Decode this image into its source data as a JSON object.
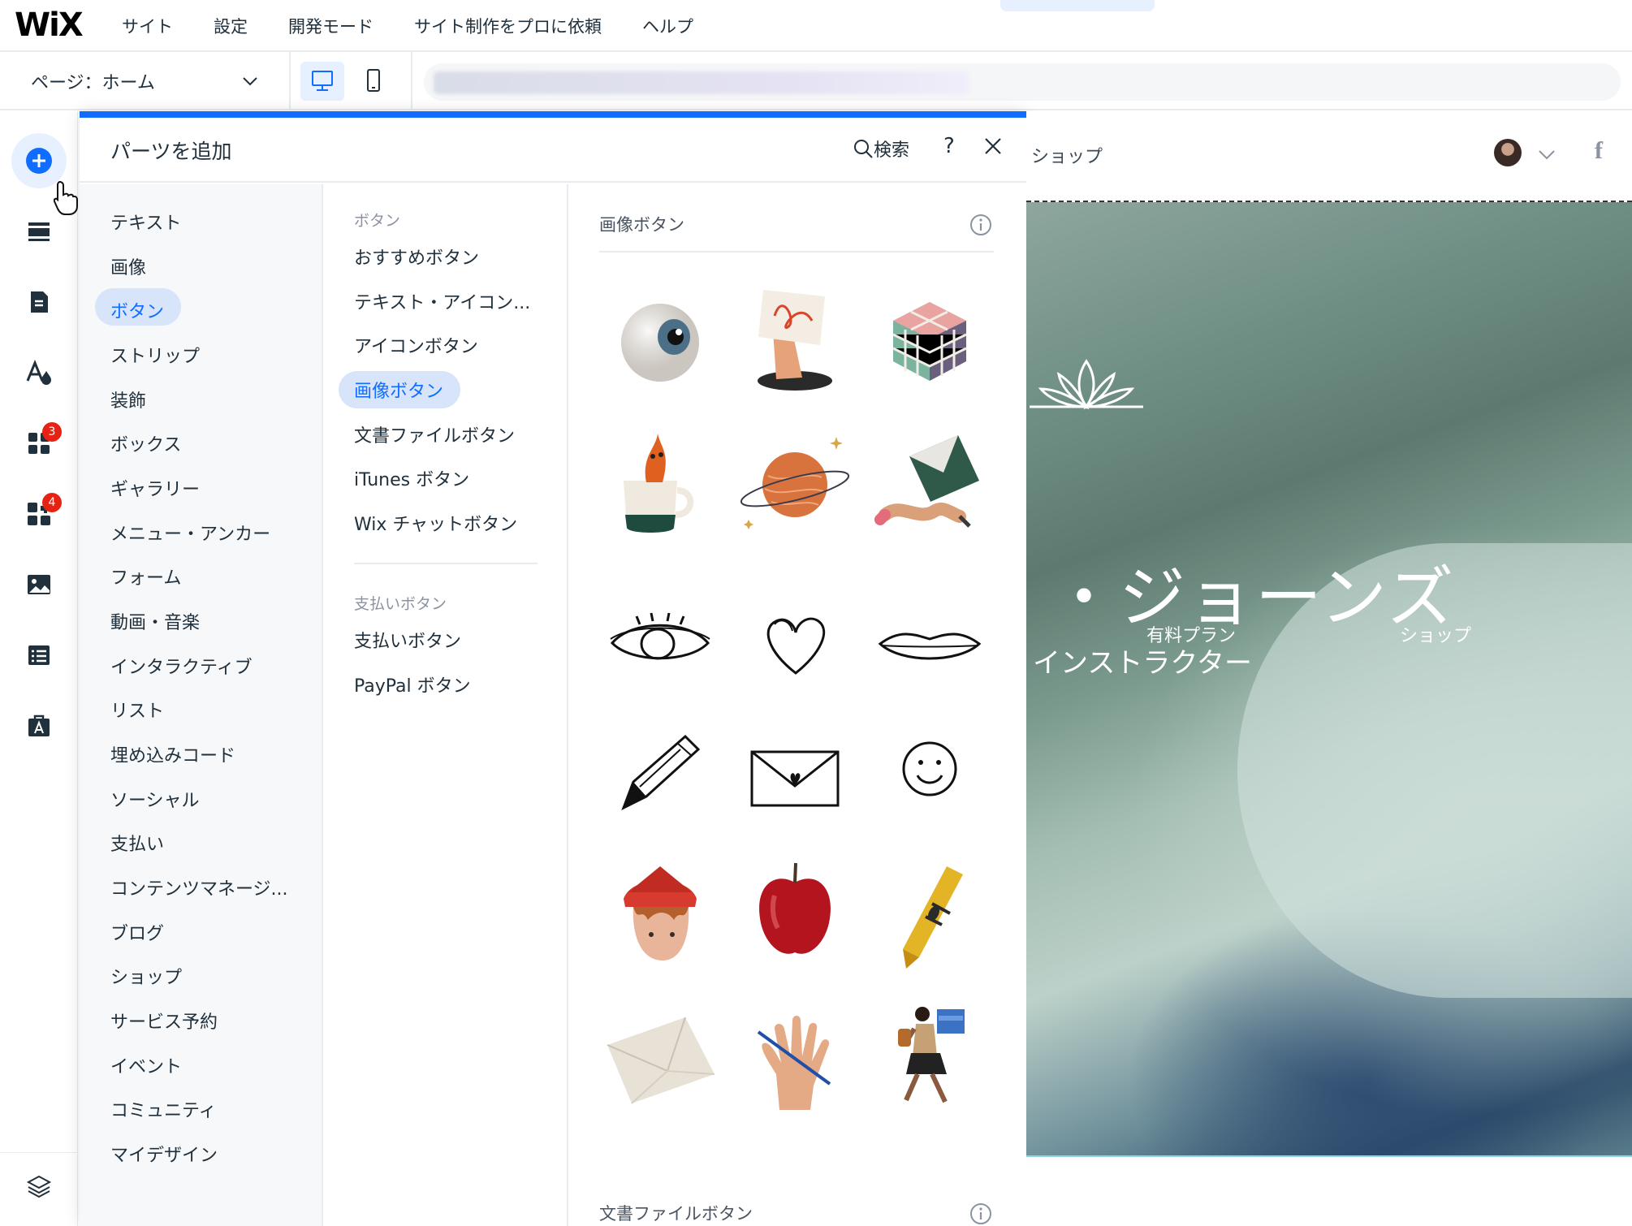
{
  "topbar": {
    "logo": "WiX",
    "menu": [
      "サイト",
      "設定",
      "開発モード",
      "サイト制作をプロに依頼",
      "ヘルプ"
    ]
  },
  "secondbar": {
    "page_selector": "ページ：ホーム",
    "device_desktop_icon": "desktop-icon",
    "device_mobile_icon": "mobile-icon"
  },
  "rail": {
    "items": [
      {
        "icon": "add-icon"
      },
      {
        "icon": "sections-icon"
      },
      {
        "icon": "pages-icon"
      },
      {
        "icon": "design-icon"
      },
      {
        "icon": "apps-icon",
        "badge": "3"
      },
      {
        "icon": "business-icon",
        "badge": "4"
      },
      {
        "icon": "media-icon"
      },
      {
        "icon": "cms-icon"
      },
      {
        "icon": "portfolio-icon"
      },
      {
        "icon": "layers-icon"
      }
    ]
  },
  "panel": {
    "title": "パーツを追加",
    "search_label": "検索",
    "help_label": "?",
    "categories": [
      "テキスト",
      "画像",
      "ボタン",
      "ストリップ",
      "装飾",
      "ボックス",
      "ギャラリー",
      "メニュー・アンカー",
      "フォーム",
      "動画・音楽",
      "インタラクティブ",
      "リスト",
      "埋め込みコード",
      "ソーシャル",
      "支払い",
      "コンテンツマネージ...",
      "ブログ",
      "ショップ",
      "サービス予約",
      "イベント",
      "コミュニティ",
      "マイデザイン"
    ],
    "selected_category": "ボタン",
    "sub_groups": [
      {
        "heading": "ボタン",
        "items": [
          "おすすめボタン",
          "テキスト・アイコン...",
          "アイコンボタン",
          "画像ボタン",
          "文書ファイルボタン",
          "iTunes ボタン",
          "Wix チャットボタン"
        ]
      },
      {
        "heading": "支払いボタン",
        "items": [
          "支払いボタン",
          "PayPal ボタン"
        ]
      }
    ],
    "selected_sub": "画像ボタン",
    "sections": [
      {
        "title": "画像ボタン"
      },
      {
        "title": "文書ファイルボタン"
      }
    ]
  },
  "site": {
    "header_link": "ショップ",
    "facebook": "f",
    "hero_title": "・ジョーンズ",
    "nav_plan": "有料プラン",
    "nav_shop": "ショップ",
    "hero_sub": "インストラクター"
  },
  "colors": {
    "accent": "#116dff",
    "selected_bg": "#d8e4f9",
    "badge": "#e62214"
  }
}
